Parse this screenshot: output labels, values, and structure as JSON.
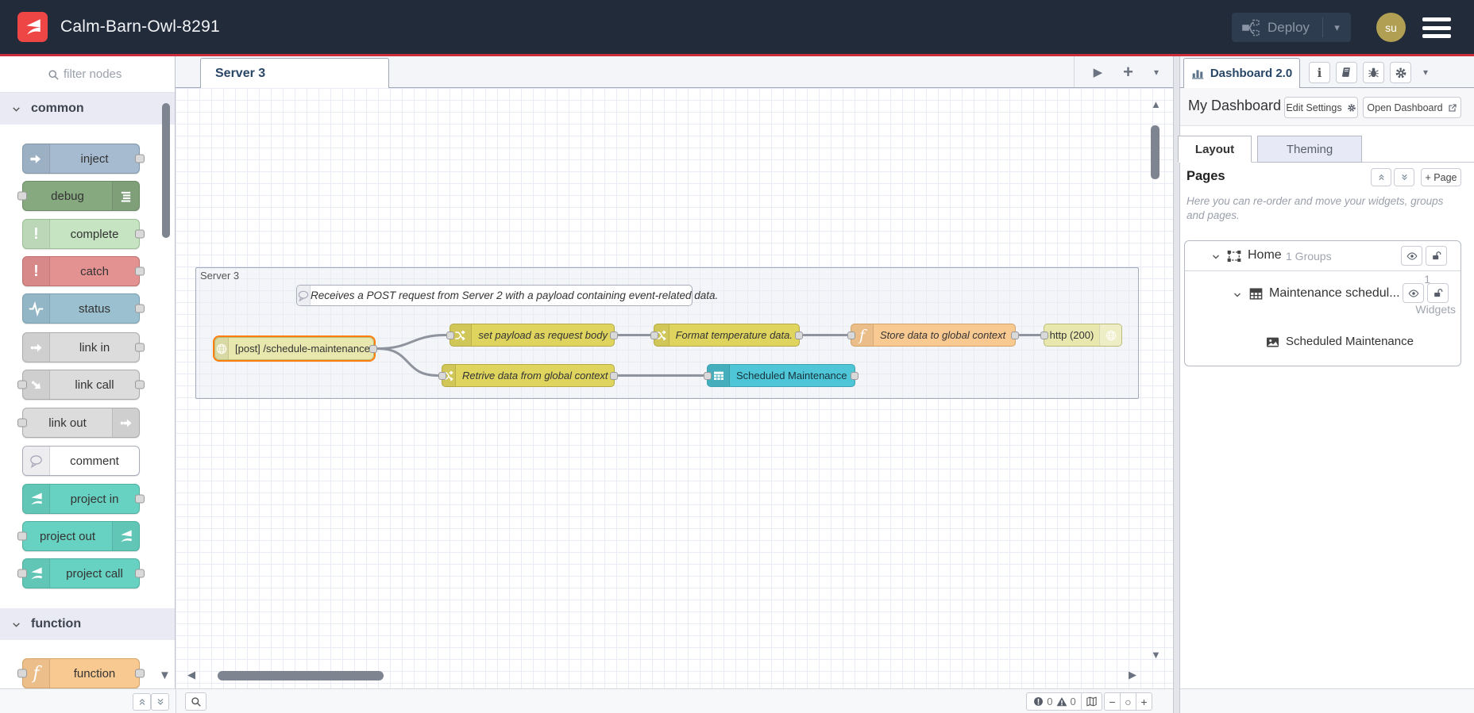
{
  "header": {
    "title": "Calm-Barn-Owl-8291",
    "deploy_label": "Deploy",
    "avatar_text": "su"
  },
  "palette": {
    "filter_placeholder": "filter nodes",
    "categories": [
      {
        "label": "common",
        "nodes": [
          "inject",
          "debug",
          "complete",
          "catch",
          "status",
          "link in",
          "link call",
          "link out",
          "comment",
          "project in",
          "project out",
          "project call"
        ]
      },
      {
        "label": "function",
        "nodes": [
          "function"
        ]
      }
    ]
  },
  "workspace": {
    "tab_label": "Server 3",
    "group_label": "Server 3",
    "comment_text": "Receives a POST request from Server 2 with a payload containing event-related data.",
    "nodes": {
      "http_in": "[post] /schedule-maintenance",
      "set_payload": "set payload as request body",
      "format_temp": "Format temperature data.",
      "store_global": "Store data to global context",
      "http_response": "http (200)",
      "retrieve_global": "Retrive data from global context",
      "ui_table": "Scheduled Maintenance"
    }
  },
  "sidebar": {
    "tab_label": "Dashboard 2.0",
    "dashboard_name": "My Dashboard",
    "edit_settings_label": "Edit Settings",
    "open_dashboard_label": "Open Dashboard",
    "layout_tab": "Layout",
    "theming_tab": "Theming",
    "pages_title": "Pages",
    "add_page_label": "+ Page",
    "hint": "Here you can re-order and move your widgets, groups and pages.",
    "tree": {
      "page_label": "Home",
      "page_meta": "1 Groups",
      "group_label": "Maintenance schedul...",
      "group_meta_count": "1",
      "group_meta_word": "Widgets",
      "widget_label": "Scheduled Maintenance"
    }
  },
  "footer": {
    "errors": "0",
    "warnings": "0"
  },
  "icons": {
    "caret_down": "▾",
    "triangle_right": "▶",
    "triangle_left": "◀",
    "triangle_up": "▲",
    "triangle_down": "▼",
    "plus": "+",
    "minus": "−",
    "circle": "○",
    "info": "i"
  },
  "colors": {
    "brand_red": "#ee4545",
    "accent_line": "#cb2e3a",
    "header_bg": "#222b3a",
    "selected_node": "#ff7f0e",
    "node_http": "#e7e7ae",
    "node_change": "#ded45e",
    "node_function": "#f9c992",
    "node_table": "#4fc6d8",
    "avatar_bg": "#b1a053"
  }
}
